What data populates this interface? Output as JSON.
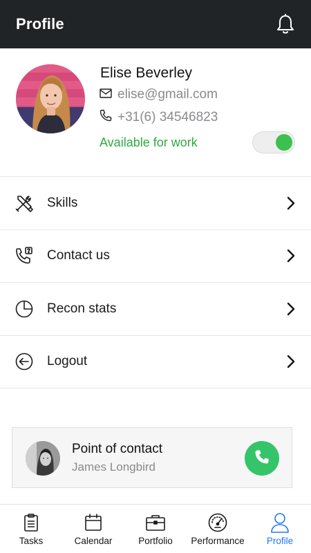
{
  "header": {
    "title": "Profile",
    "notification_icon": "bell-icon"
  },
  "profile": {
    "name": "Elise Beverley",
    "email": "elise@gmail.com",
    "phone": "+31(6) 34546823",
    "availability_label": "Available for work",
    "available": true,
    "accent_color": "#3cc04e"
  },
  "menu": {
    "items": [
      {
        "label": "Skills",
        "icon": "tools-icon"
      },
      {
        "label": "Contact us",
        "icon": "phone-help-icon"
      },
      {
        "label": "Recon stats",
        "icon": "pie-chart-icon"
      },
      {
        "label": "Logout",
        "icon": "logout-icon"
      }
    ]
  },
  "contact": {
    "title": "Point of contact",
    "name": "James Longbird",
    "call_icon": "phone-icon",
    "call_color": "#35c46a"
  },
  "tabbar": {
    "items": [
      {
        "label": "Tasks",
        "icon": "clipboard-icon",
        "active": false
      },
      {
        "label": "Calendar",
        "icon": "calendar-icon",
        "active": false
      },
      {
        "label": "Portfolio",
        "icon": "briefcase-icon",
        "active": false
      },
      {
        "label": "Performance",
        "icon": "gauge-icon",
        "active": false
      },
      {
        "label": "Profile",
        "icon": "user-icon",
        "active": true
      }
    ],
    "active_color": "#1f78f0"
  }
}
